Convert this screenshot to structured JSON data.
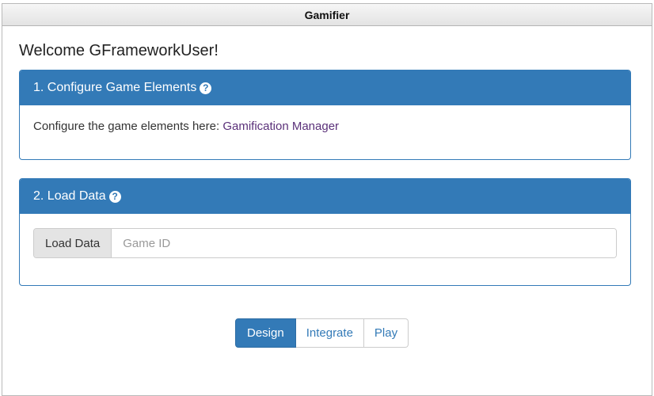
{
  "window": {
    "title": "Gamifier"
  },
  "welcome": "Welcome GFrameworkUser!",
  "panels": [
    {
      "heading": "1. Configure Game Elements",
      "help_icon": "question-circle",
      "body_text": "Configure the game elements here: ",
      "link_text": "Gamification Manager"
    },
    {
      "heading": "2. Load Data",
      "help_icon": "question-circle",
      "addon_label": "Load Data",
      "input_placeholder": "Game ID",
      "input_value": ""
    }
  ],
  "mode_tabs": {
    "items": [
      "Design",
      "Integrate",
      "Play"
    ],
    "active": "Design"
  },
  "colors": {
    "primary": "#337ab7",
    "link": "#5a3079",
    "addon_bg": "#e4e4e4"
  }
}
